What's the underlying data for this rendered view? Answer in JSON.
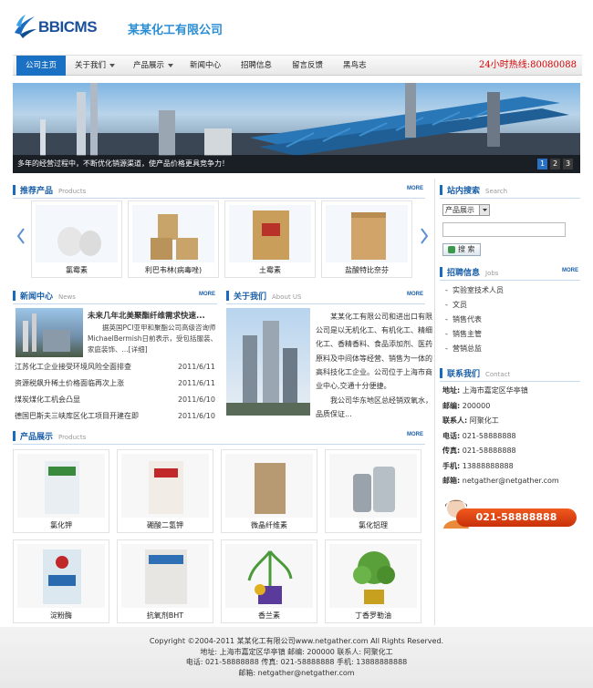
{
  "brand": {
    "logo_text": "BBICMS",
    "company": "某某化工有限公司"
  },
  "nav": {
    "items": [
      "公司主页",
      "关于我们",
      "产品展示",
      "新闻中心",
      "招聘信息",
      "留言反馈",
      "黑鸟志"
    ],
    "hotline": "24小时热线:80080088"
  },
  "banner": {
    "caption": "多年的经营过程中，不断优化销源渠道，使产品价格更具竞争力！",
    "pages": [
      "1",
      "2",
      "3"
    ],
    "active_page": "1"
  },
  "recommend": {
    "title": "推荐产品",
    "subtitle": "Products",
    "more": "MORE",
    "items": [
      "氯霉素",
      "利巴韦林(病毒唑)",
      "土霉素",
      "盐酸特比奈芬"
    ]
  },
  "news": {
    "title": "新闻中心",
    "subtitle": "News",
    "more": "MORE",
    "headline": "未来几年北美聚酯纤维需求快速...",
    "summary": "据英国PCI亚甲和聚酯公司高级咨询师MichaelBermish日前表示，受包括服装、家庭装饰、...[详细]",
    "list": [
      {
        "text": "江苏化工企业接受环境风险全面排查",
        "date": "2011/6/11"
      },
      {
        "text": "资源税飙升稀土价格面临再次上涨",
        "date": "2011/6/11"
      },
      {
        "text": "煤炭煤化工机会凸显",
        "date": "2011/6/10"
      },
      {
        "text": "德国巴斯夫三峡库区化工项目开建在即",
        "date": "2011/6/10"
      }
    ]
  },
  "about": {
    "title": "关于我们",
    "subtitle": "About US",
    "more": "MORE",
    "p1": "某某化工有限公司和进出口有限公司是以无机化工、有机化工、精细化工、香精香料、食品添加剂、医药原料及中间体等经营、销售为一体的高科技化工企业。公司位于上海市商业中心,交通十分便捷。",
    "p2": "我公司华东地区总经销双氧水，品质保证..."
  },
  "products": {
    "title": "产品展示",
    "subtitle": "Products",
    "more": "MORE",
    "items": [
      "氯化钾",
      "硼酸二氢钾",
      "微晶纤维素",
      "氯化铝理",
      "淀粉酶",
      "抗氧剂BHT",
      "香兰素",
      "丁香罗勒油"
    ]
  },
  "search": {
    "title": "站内搜索",
    "subtitle": "Search",
    "select": "产品展示",
    "button": "搜 索"
  },
  "jobs": {
    "title": "招聘信息",
    "subtitle": "Jobs",
    "more": "MORE",
    "items": [
      "实验室技术人员",
      "文员",
      "销售代表",
      "销售主管",
      "营销总监"
    ]
  },
  "contact": {
    "title": "联系我们",
    "subtitle": "Contact",
    "rows": [
      {
        "k": "地址:",
        "v": "上海市嘉定区华亭镇"
      },
      {
        "k": "邮编:",
        "v": "200000"
      },
      {
        "k": "联系人:",
        "v": "阿聚化工"
      },
      {
        "k": "电话:",
        "v": "021-58888888"
      },
      {
        "k": "传真:",
        "v": "021-58888888"
      },
      {
        "k": "手机:",
        "v": "13888888888"
      },
      {
        "k": "邮箱:",
        "v": "netgather@netgather.com"
      }
    ],
    "hotline": "021-58888888"
  },
  "footer": {
    "lines": [
      "Copyright ©2004-2011 某某化工有限公司www.netgather.com All Rights Reserved.",
      "地址: 上海市嘉定区华亭镇    邮编: 200000    联系人: 阿聚化工",
      "电话: 021-58888888    传真: 021-58888888    手机: 13888888888",
      "邮箱: netgather@netgather.com"
    ]
  },
  "colors": {
    "accent": "#1a70c2",
    "hotline": "#d40000"
  }
}
